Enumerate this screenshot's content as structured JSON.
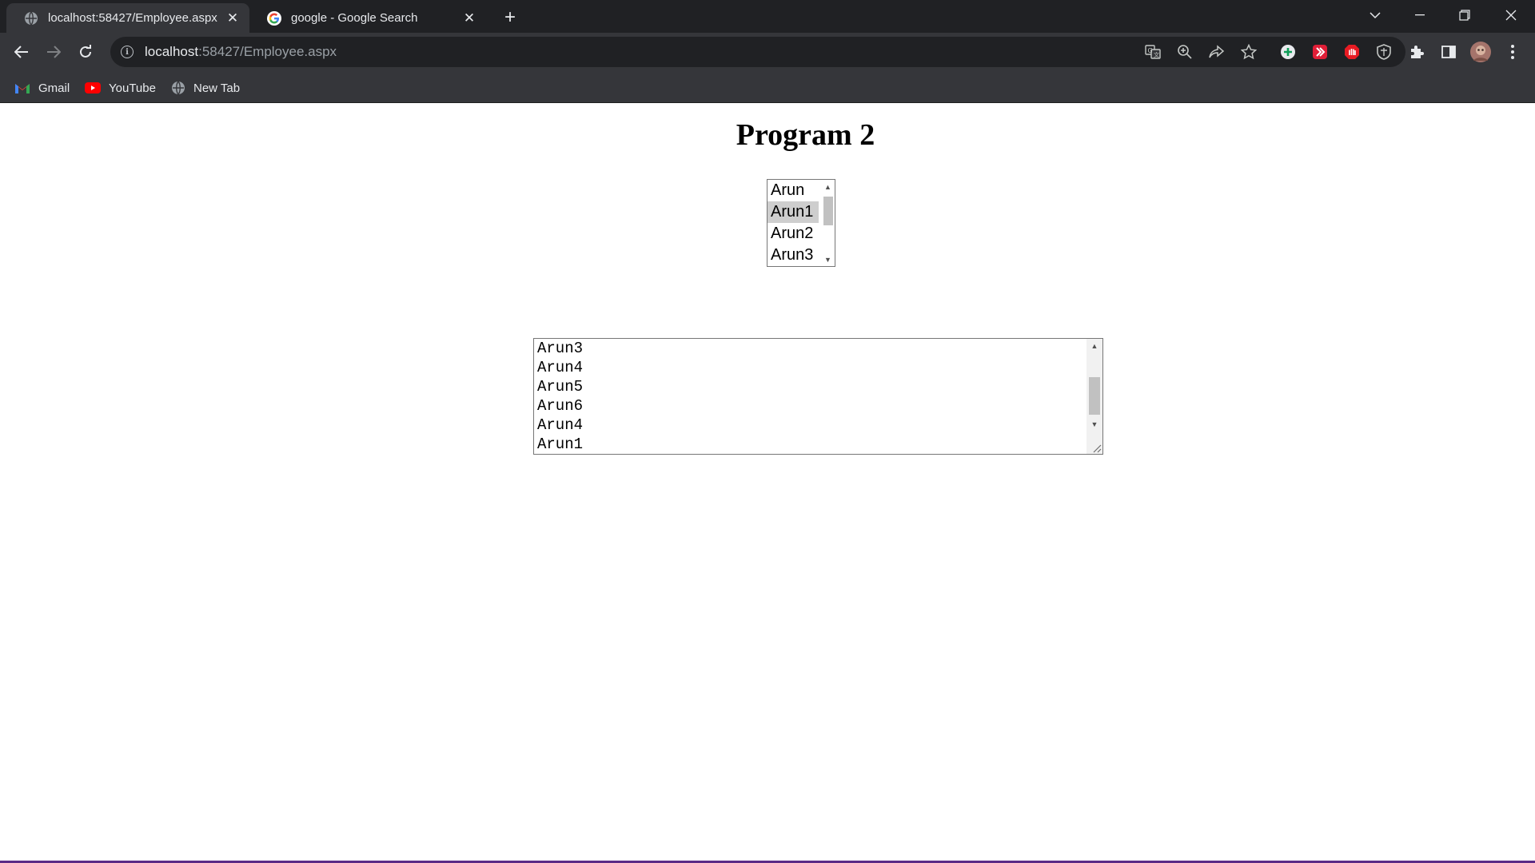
{
  "tabs": [
    {
      "label": "localhost:58427/Employee.aspx",
      "active": true,
      "icon": "globe-icon"
    },
    {
      "label": "google - Google Search",
      "active": false,
      "icon": "google-icon"
    }
  ],
  "toolbar": {
    "url_host": "localhost",
    "url_path": ":58427/Employee.aspx"
  },
  "bookmarks": [
    {
      "label": "Gmail",
      "icon": "gmail-icon"
    },
    {
      "label": "YouTube",
      "icon": "youtube-icon"
    },
    {
      "label": "New Tab",
      "icon": "globe-icon"
    }
  ],
  "page": {
    "title": "Program 2",
    "listbox": {
      "options": [
        "Arun",
        "Arun1",
        "Arun2",
        "Arun3"
      ],
      "selected": "Arun1"
    },
    "textarea": {
      "lines": [
        "Arun3",
        "Arun4",
        "Arun5",
        "Arun6",
        "Arun4",
        "Arun1"
      ]
    }
  },
  "colors": {
    "chrome_bg": "#202124",
    "toolbar_bg": "#35363a",
    "selection_bg": "#cecece"
  }
}
